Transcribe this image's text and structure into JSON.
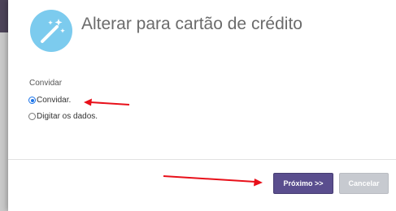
{
  "dialog": {
    "title": "Alterar para cartão de crédito",
    "icon": "magic-wand-icon"
  },
  "form": {
    "group_label": "Convidar",
    "options": [
      {
        "label": "Convidar.",
        "checked": true
      },
      {
        "label": "Digitar os dados.",
        "checked": false
      }
    ]
  },
  "footer": {
    "next_label": "Próximo >>",
    "cancel_label": "Cancelar"
  },
  "colors": {
    "icon_circle": "#7ccbee",
    "primary_button": "#5a4e8e",
    "disabled_button": "#c7cad0",
    "annotation_arrow": "#e8101a",
    "backdrop": "#4d4459"
  }
}
